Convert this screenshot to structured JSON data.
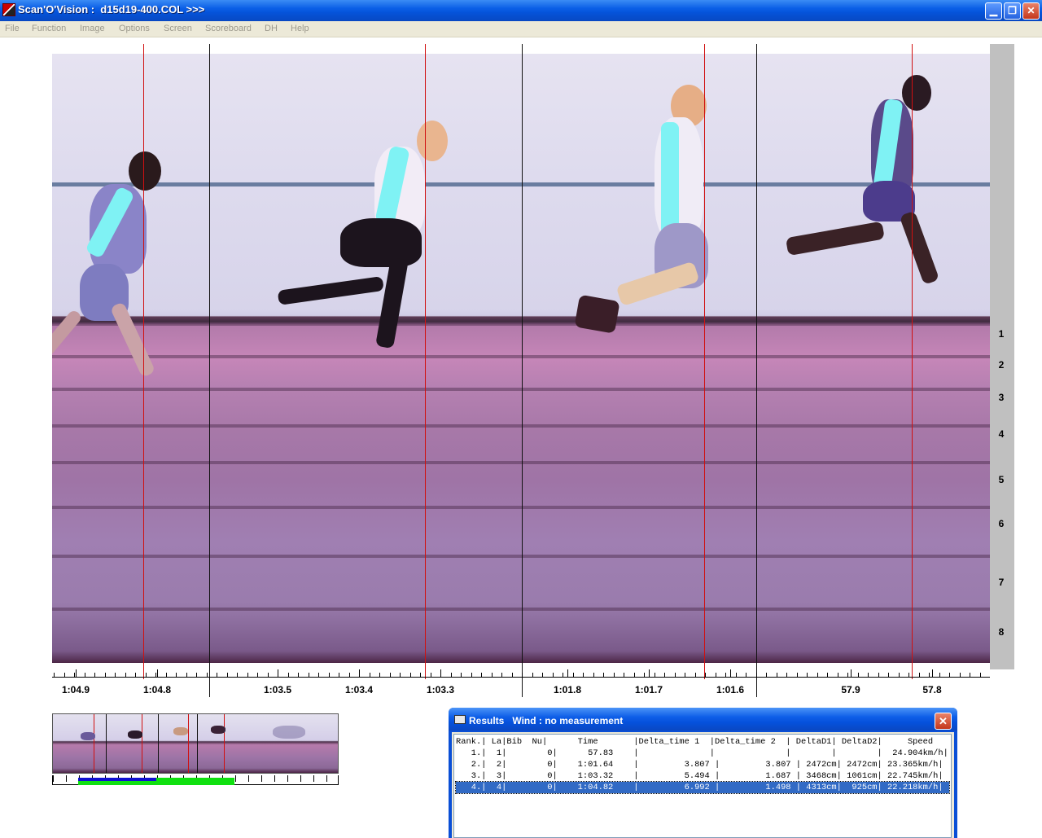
{
  "window": {
    "title": "Scan'O'Vision :  d15d19-400.COL >>>",
    "min_icon": "minimize-icon",
    "max_icon": "restore-icon",
    "close_icon": "close-icon",
    "min_glyph": "▁",
    "max_glyph": "❐",
    "close_glyph": "✕"
  },
  "menu": [
    "File",
    "Function",
    "Image",
    "Options",
    "Screen",
    "Scoreboard",
    "DH",
    "Help"
  ],
  "lanes": [
    "1",
    "2",
    "3",
    "4",
    "5",
    "6",
    "7",
    "8"
  ],
  "time_axis": {
    "labels": [
      "1:04.9",
      "1:04.8",
      "1:03.5",
      "1:03.4",
      "1:03.3",
      "1:01.8",
      "1:01.7",
      "1:01.6",
      "57.9",
      "57.8"
    ]
  },
  "colors": {
    "finish_line": "#d01010",
    "separator": "#111111",
    "highlight": "#7ff2f4",
    "selection": "#316ac5"
  },
  "results": {
    "title": "Results   Wind : no measurement",
    "icon": "printer-icon",
    "close_glyph": "✕",
    "header": "Rank.| La|Bib  Nu|      Time       |Delta_time 1  |Delta_time 2  | DeltaD1| DeltaD2|     Speed     |",
    "rows": [
      "   1.|  1|        0|      57.83    |              |              |        |        |  24.904km/h|",
      "   2.|  2|        0|    1:01.64    |         3.807 |         3.807 | 2472cm| 2472cm| 23.365km/h|",
      "   3.|  3|        0|    1:03.32    |         5.494 |         1.687 | 3468cm| 1061cm| 22.745km/h|",
      "   4.|  4|        0|    1:04.82    |         6.992 |         1.498 | 4313cm|  925cm| 22.218km/h|"
    ],
    "selected_row": 3
  }
}
